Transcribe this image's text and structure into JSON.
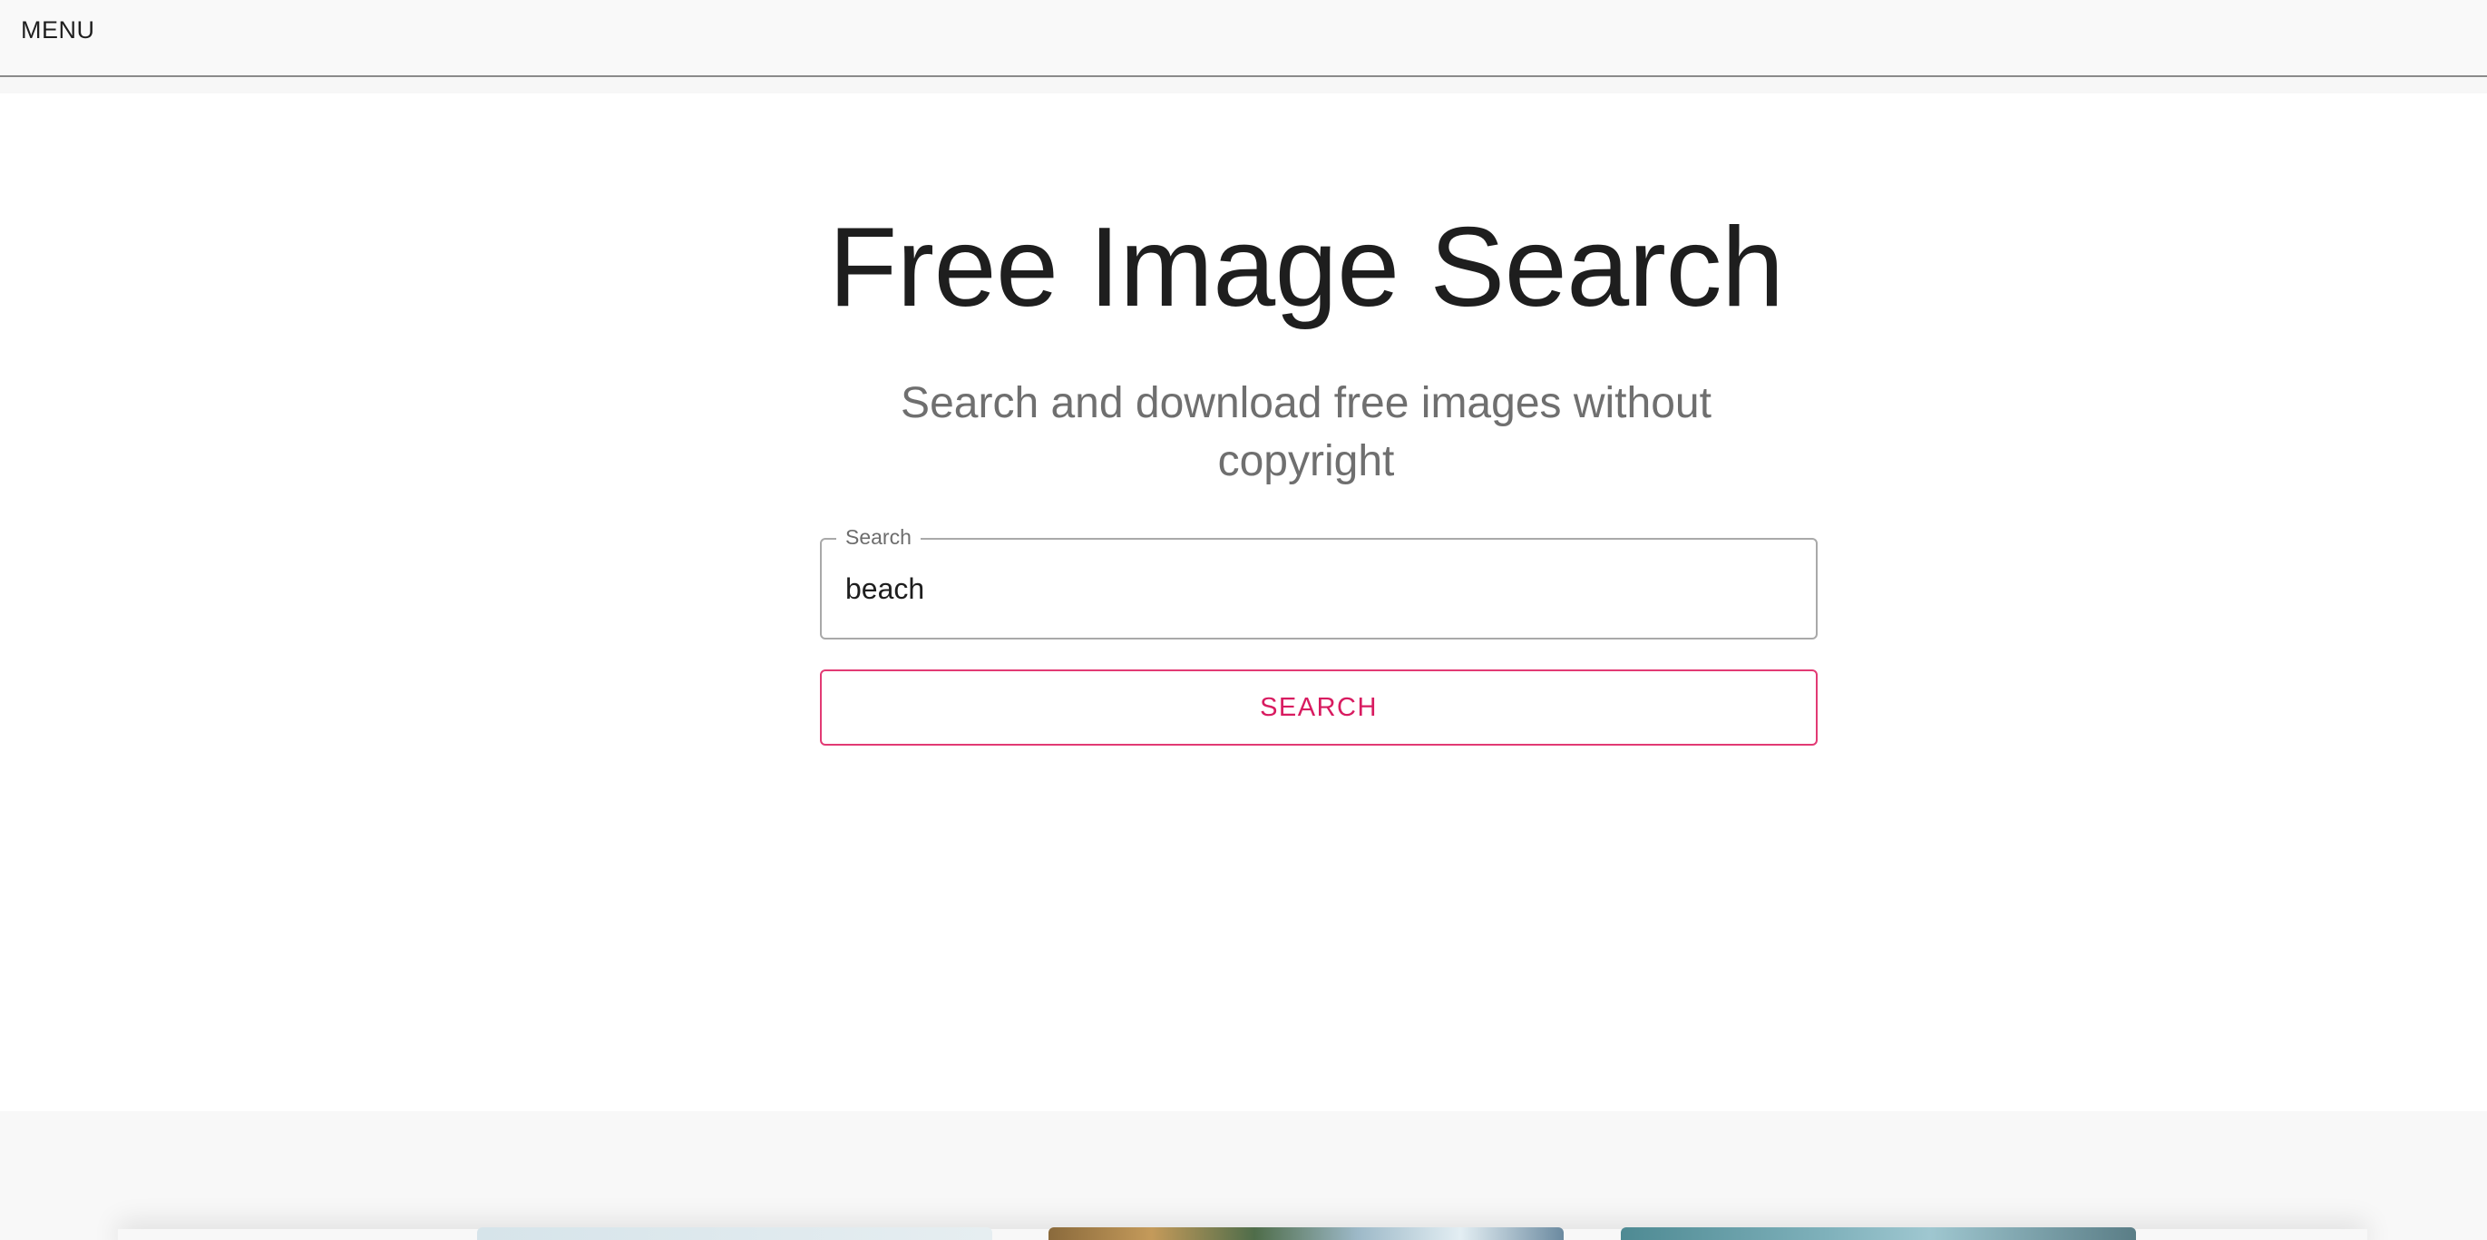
{
  "topbar": {
    "menu_label": "MENU"
  },
  "hero": {
    "title": "Free Image Search",
    "subtitle": "Search and download free images without copyright"
  },
  "search": {
    "legend": "Search",
    "value": "beach",
    "button_label": "SEARCH"
  },
  "colors": {
    "accent": "#d81b60",
    "topbar_bg": "#f9f9f9"
  }
}
